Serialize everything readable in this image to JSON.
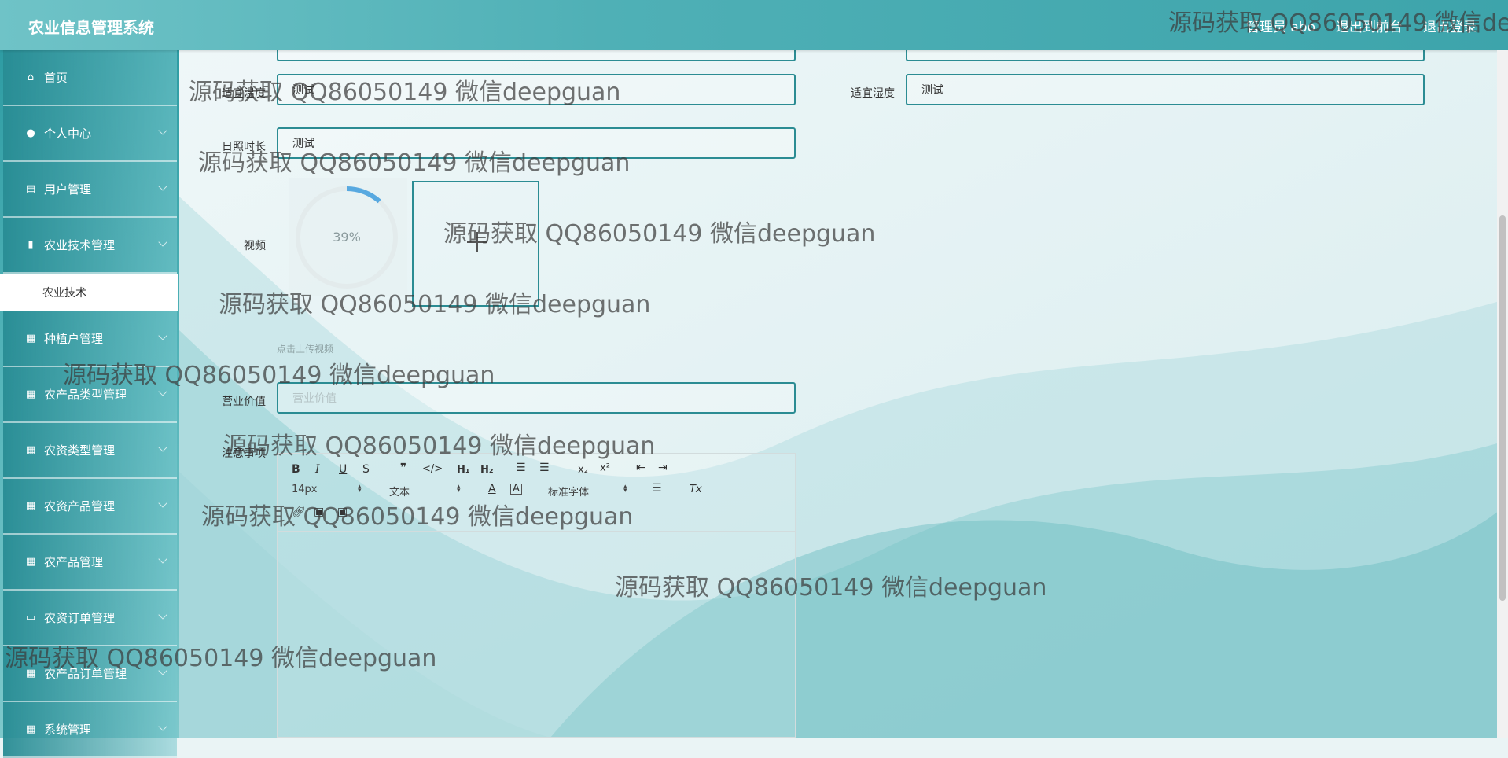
{
  "app_title": "农业信息管理系统",
  "header_links": [
    "管理员 abo",
    "退出到前台",
    "退出登录"
  ],
  "sidebar": {
    "items": [
      {
        "label": "首页",
        "icon": "home-icon",
        "glyph": "⌂",
        "chevron": false
      },
      {
        "label": "个人中心",
        "icon": "user-icon",
        "glyph": "●",
        "chevron": true
      },
      {
        "label": "用户管理",
        "icon": "clipboard-icon",
        "glyph": "▤",
        "chevron": true
      },
      {
        "label": "农业技术管理",
        "icon": "bar-chart-icon",
        "glyph": "▮",
        "chevron": true
      },
      {
        "label": "种植户管理",
        "icon": "grid-icon",
        "glyph": "▦",
        "chevron": true
      },
      {
        "label": "农产品类型管理",
        "icon": "grid-icon",
        "glyph": "▦",
        "chevron": true
      },
      {
        "label": "农资类型管理",
        "icon": "grid-icon",
        "glyph": "▦",
        "chevron": true
      },
      {
        "label": "农资产品管理",
        "icon": "grid-icon",
        "glyph": "▦",
        "chevron": true
      },
      {
        "label": "农产品管理",
        "icon": "grid-icon",
        "glyph": "▦",
        "chevron": true
      },
      {
        "label": "农资订单管理",
        "icon": "monitor-icon",
        "glyph": "▭",
        "chevron": true
      },
      {
        "label": "农产品订单管理",
        "icon": "grid-icon",
        "glyph": "▦",
        "chevron": true
      },
      {
        "label": "系统管理",
        "icon": "grid-icon",
        "glyph": "▦",
        "chevron": true
      }
    ],
    "active_sub": "农业技术"
  },
  "form": {
    "temperature_label": "适宜温度",
    "temperature_value": "测试",
    "humidity_label": "适宜湿度",
    "humidity_value": "测试",
    "sunlight_label": "日照时长",
    "sunlight_value": "测试",
    "video_label": "视频",
    "upload_progress": "39%",
    "upload_progress_fraction": 0.39,
    "upload_hint": "点击上传视频",
    "value_label": "营业价值",
    "value_placeholder": "营业价值",
    "notes_label": "注意事项"
  },
  "editor_toolbar": {
    "font_size": "14px",
    "text_style": "文本",
    "font_family": "标准字体"
  },
  "watermark": "源码获取 QQ86050149 微信deepguan",
  "colors": {
    "primary": "#2b8c93",
    "header": "#4fb0b6"
  }
}
